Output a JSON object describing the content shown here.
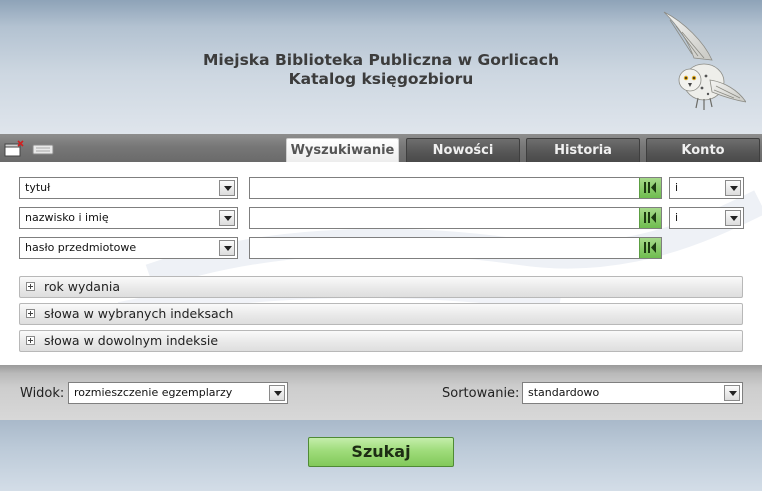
{
  "header": {
    "title_line1": "Miejska Biblioteka Publiczna w Gorlicach",
    "title_line2": "Katalog księgozbioru"
  },
  "toolbar_icons": [
    "new-window-icon",
    "keyboard-icon"
  ],
  "tabs": [
    {
      "label": "Wyszukiwanie",
      "active": true
    },
    {
      "label": "Nowości",
      "active": false
    },
    {
      "label": "Historia",
      "active": false
    },
    {
      "label": "Konto",
      "active": false
    }
  ],
  "search_rows": [
    {
      "field": "tytuł",
      "value": "",
      "operator": "i"
    },
    {
      "field": "nazwisko i imię",
      "value": "",
      "operator": "i"
    },
    {
      "field": "hasło przedmiotowe",
      "value": ""
    }
  ],
  "collapsibles": [
    "rok wydania",
    "słowa w wybranych indeksach",
    "słowa w dowolnym indeksie"
  ],
  "options": {
    "view_label": "Widok:",
    "view_value": "rozmieszczenie egzemplarzy",
    "sort_label": "Sortowanie:",
    "sort_value": "standardowo"
  },
  "search_button": "Szukaj",
  "colors": {
    "tab_active_text": "#555555",
    "tab_inactive_bg": "#555555",
    "search_button": "#9fdc7b",
    "keyboard_button": "#6fbd4f"
  }
}
